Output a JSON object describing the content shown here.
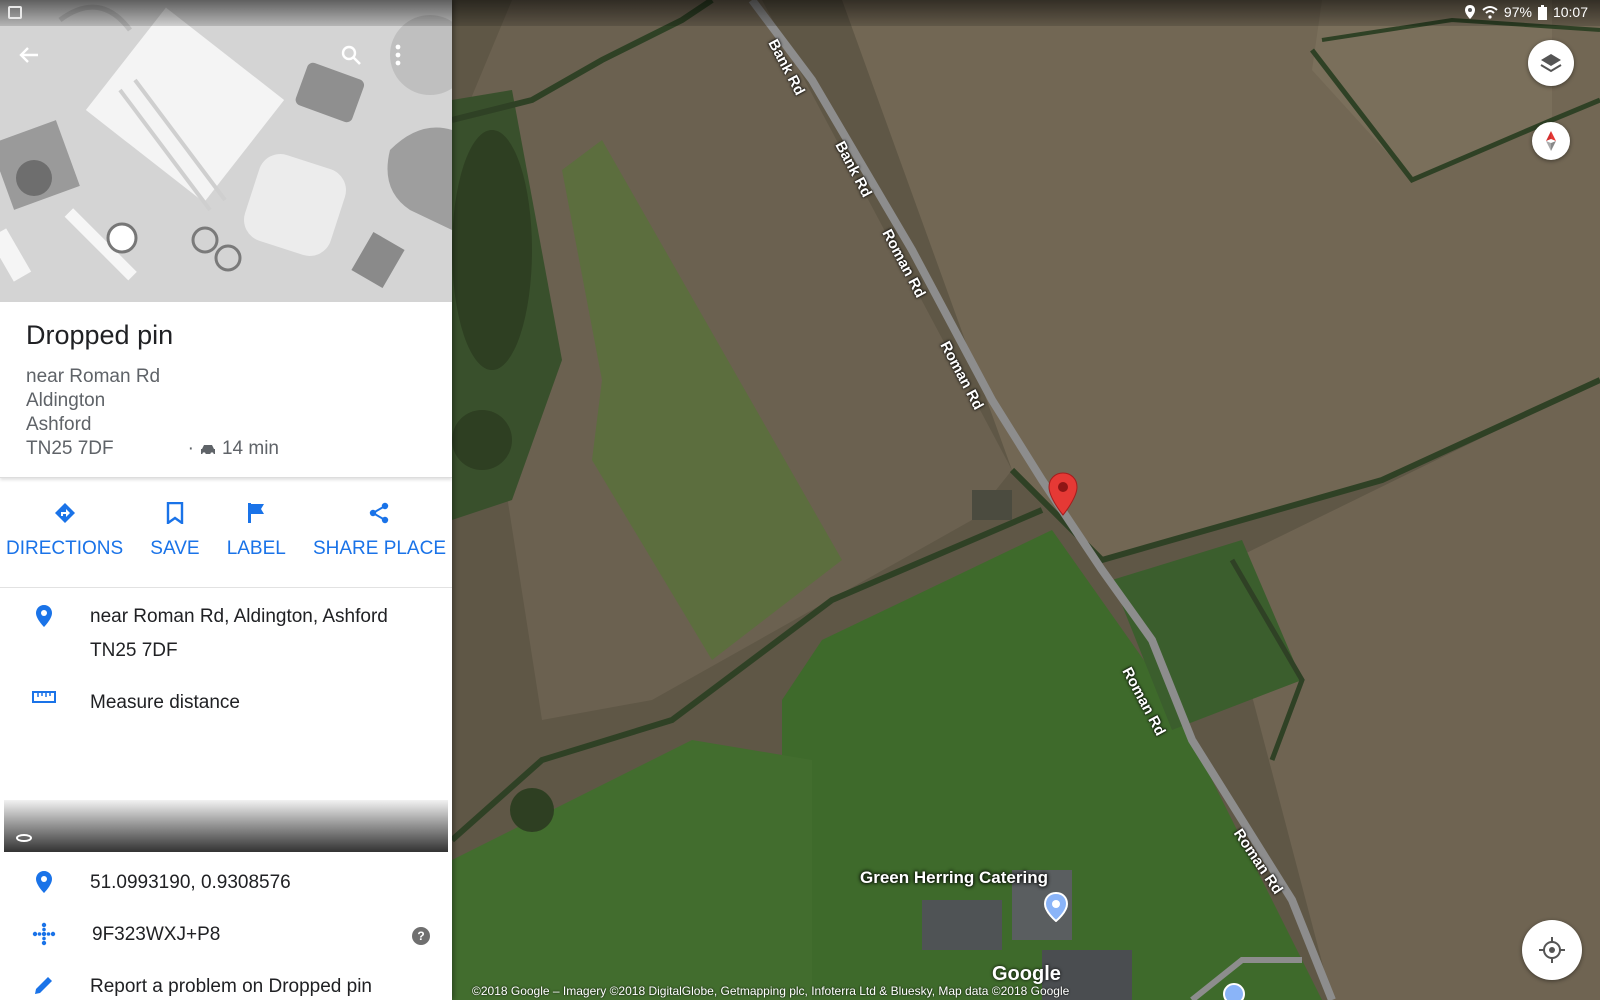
{
  "status_bar": {
    "battery": "97%",
    "time": "10:07"
  },
  "panel": {
    "title": "Dropped pin",
    "address_lines": [
      "near Roman Rd",
      "Aldington",
      "Ashford",
      "TN25 7DF"
    ],
    "travel_separator": "·",
    "travel_time": "14 min",
    "actions": [
      {
        "label": "DIRECTIONS",
        "icon": "directions-icon"
      },
      {
        "label": "SAVE",
        "icon": "bookmark-icon"
      },
      {
        "label": "LABEL",
        "icon": "flag-icon"
      },
      {
        "label": "SHARE PLACE",
        "icon": "share-icon"
      }
    ],
    "full_address_line1": "near Roman Rd, Aldington, Ashford",
    "full_address_line2": "TN25 7DF",
    "measure_distance": "Measure distance",
    "coordinates": "51.0993190, 0.9308576",
    "plus_code": "9F323WXJ+P8",
    "help_glyph": "?",
    "report": "Report a problem on Dropped pin"
  },
  "map": {
    "road_labels": [
      "Bank Rd",
      "Bank Rd",
      "Roman Rd",
      "Roman Rd",
      "Roman Rd",
      "Roman Rd"
    ],
    "poi_label": "Green Herring Catering",
    "google_logo": "Google",
    "attribution": "©2018 Google – Imagery ©2018 DigitalGlobe, Getmapping plc, Infoterra Ltd & Bluesky, Map data ©2018 Google",
    "colors": {
      "pin": "#e53935",
      "field_brown": "#6e6553",
      "field_green": "#3f6b2e",
      "road": "#8d8d8d",
      "accent": "#1a73e8"
    }
  }
}
